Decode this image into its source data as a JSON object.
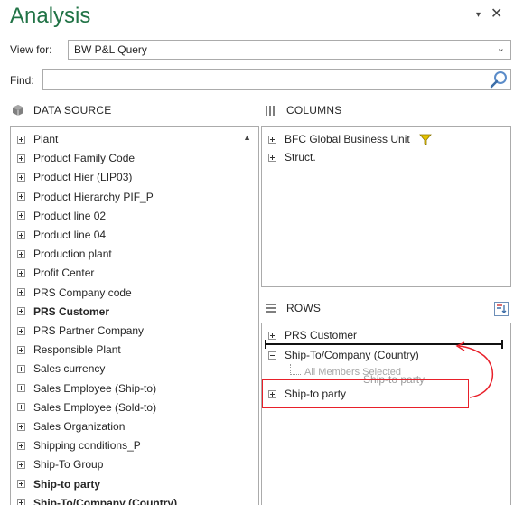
{
  "title": "Analysis",
  "window_controls": {
    "dropdown_glyph": "▾",
    "close_glyph": "✕"
  },
  "view_for": {
    "label": "View for:",
    "value": "BW P&L Query"
  },
  "find": {
    "label": "Find:",
    "value": ""
  },
  "data_source": {
    "heading": "DATA SOURCE",
    "items": [
      {
        "label": "Plant",
        "bold": false
      },
      {
        "label": "Product Family Code",
        "bold": false
      },
      {
        "label": "Product Hier (LIP03)",
        "bold": false
      },
      {
        "label": "Product Hierarchy PIF_P",
        "bold": false
      },
      {
        "label": "Product line 02",
        "bold": false
      },
      {
        "label": "Product line 04",
        "bold": false
      },
      {
        "label": "Production plant",
        "bold": false
      },
      {
        "label": "Profit Center",
        "bold": false
      },
      {
        "label": "PRS Company code",
        "bold": false
      },
      {
        "label": "PRS Customer",
        "bold": true
      },
      {
        "label": "PRS Partner Company",
        "bold": false
      },
      {
        "label": "Responsible Plant",
        "bold": false
      },
      {
        "label": "Sales currency",
        "bold": false
      },
      {
        "label": "Sales Employee (Ship-to)",
        "bold": false
      },
      {
        "label": "Sales Employee (Sold-to)",
        "bold": false
      },
      {
        "label": "Sales Organization",
        "bold": false
      },
      {
        "label": "Shipping conditions_P",
        "bold": false
      },
      {
        "label": "Ship-To Group",
        "bold": false
      },
      {
        "label": "Ship-to party",
        "bold": true
      },
      {
        "label": "Ship-To/Company (Country)",
        "bold": true
      }
    ]
  },
  "columns": {
    "heading": "COLUMNS",
    "items": [
      {
        "label": "BFC Global Business Unit",
        "filtered": true
      },
      {
        "label": "Struct.",
        "filtered": false
      }
    ]
  },
  "rows": {
    "heading": "ROWS",
    "items": [
      {
        "label": "PRS Customer"
      },
      {
        "label": "Ship-To/Company (Country)",
        "child": "All Members Selected"
      },
      {
        "label": "Ship-to party"
      }
    ],
    "drag_ghost": "Ship-to party"
  },
  "colors": {
    "title_green": "#217346",
    "highlight_red": "#e8202a",
    "filter_yellow": "#e6c300"
  }
}
